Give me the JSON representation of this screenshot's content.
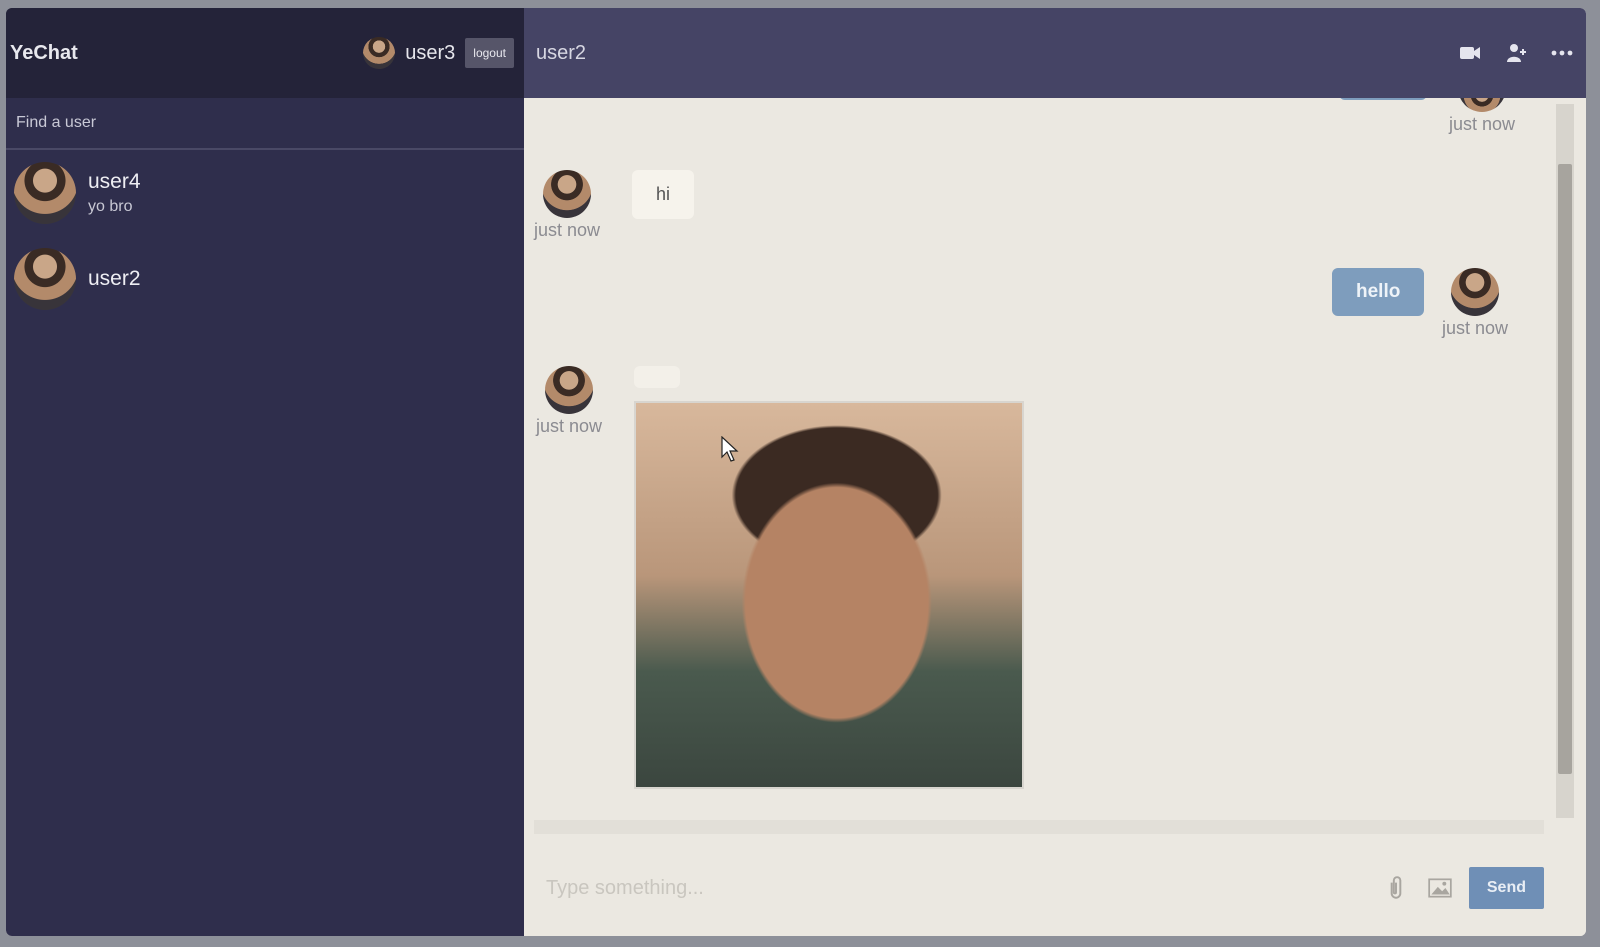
{
  "app": {
    "title": "YeChat"
  },
  "current_user": {
    "name": "user3",
    "logout_label": "logout"
  },
  "search": {
    "placeholder": "Find a user"
  },
  "contacts": [
    {
      "name": "user4",
      "preview": "yo bro"
    },
    {
      "name": "user2",
      "preview": ""
    }
  ],
  "chat": {
    "peer_name": "user2",
    "header_icons": [
      "video-camera-icon",
      "add-user-icon",
      "more-icon"
    ],
    "messages": [
      {
        "direction": "out",
        "text": "",
        "timestamp": "just now"
      },
      {
        "direction": "in",
        "text": "hi",
        "timestamp": "just now"
      },
      {
        "direction": "out",
        "text": "hello",
        "timestamp": "just now"
      },
      {
        "direction": "in",
        "type": "image",
        "text": "",
        "timestamp": "just now"
      }
    ],
    "composer": {
      "placeholder": "Type something...",
      "send_label": "Send",
      "icons": [
        "paperclip-icon",
        "image-icon"
      ]
    }
  },
  "colors": {
    "sidebar_bg": "#2f2e4c",
    "header_bg": "#454465",
    "outgoing_bubble": "#7e9dbd",
    "send_button": "#6f8fb6"
  }
}
